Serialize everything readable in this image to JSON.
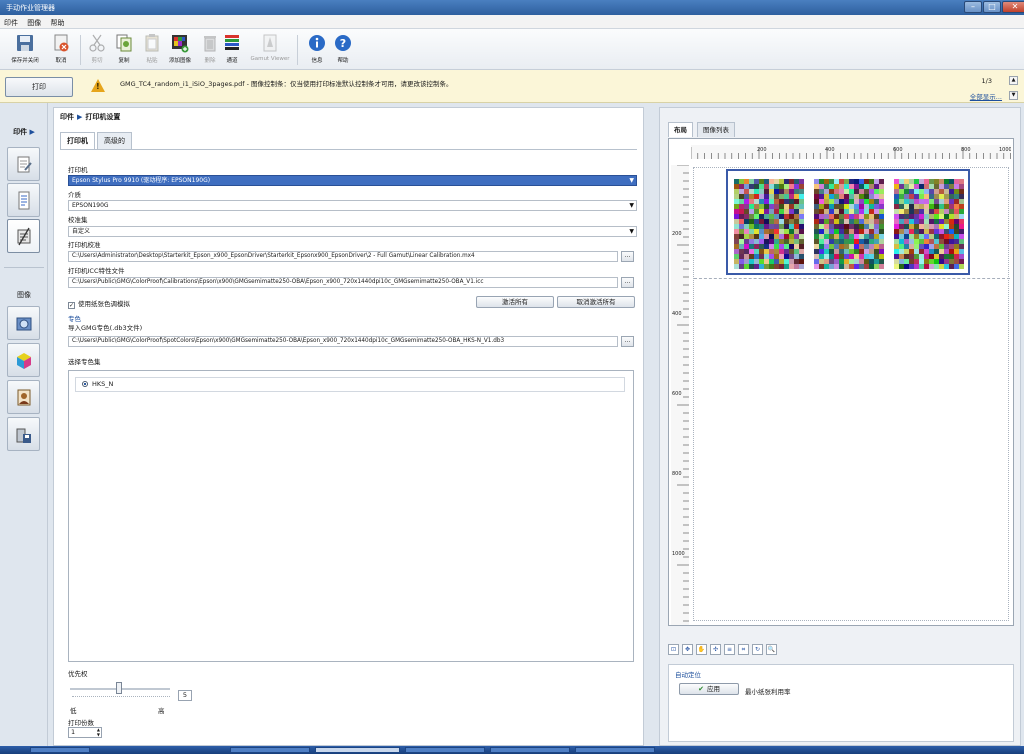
{
  "window": {
    "title": "手动作业管理器"
  },
  "menu": [
    "印件",
    "图像",
    "帮助"
  ],
  "toolbar": {
    "buttons": [
      {
        "label": "保存并关闭",
        "icon": "save-icon",
        "disabled": false
      },
      {
        "label": "取消",
        "icon": "cancel-icon",
        "disabled": false
      },
      {
        "label": "剪切",
        "icon": "scissors-icon",
        "disabled": true
      },
      {
        "label": "复制",
        "icon": "copy-icon",
        "disabled": false
      },
      {
        "label": "粘贴",
        "icon": "paste-icon",
        "disabled": true
      },
      {
        "label": "添加图像",
        "icon": "add-image-icon",
        "disabled": false
      },
      {
        "label": "删除",
        "icon": "trash-icon",
        "disabled": true
      },
      {
        "label": "通道",
        "icon": "channels-icon",
        "disabled": false
      },
      {
        "label": "Gamut Viewer",
        "icon": "gamut-viewer-icon",
        "disabled": true
      },
      {
        "label": "信息",
        "icon": "info-icon",
        "disabled": false
      },
      {
        "label": "帮助",
        "icon": "help-icon",
        "disabled": false
      }
    ]
  },
  "notice": {
    "print_button": "打印",
    "message": "GMG_TC4_random_i1_iSiO_3pages.pdf - 图像控制条：仅当使用打印标准默认控制条才可用，请更改该控制条。",
    "page_counter": "1/3",
    "show_all": "全部显示..."
  },
  "left_nav": {
    "section1": "印件",
    "section2": "图像"
  },
  "main": {
    "breadcrumb": {
      "root": "印件",
      "current": "打印机设置"
    },
    "tabs": [
      "打印机",
      "高级的"
    ],
    "printer_label": "打印机",
    "printer_value": "Epson Stylus Pro 9910 (驱动程序: EPSON190G)",
    "media_label": "介质",
    "media_value": "EPSON190G",
    "calibset_label": "校准集",
    "calibset_value": "自定义",
    "calib_label": "打印机校准",
    "calib_value": "C:\\Users\\Administrator\\Desktop\\Starterkit_Epson_x900_EpsonDriver\\Starterkit_Epsonx900_EpsonDriver\\2 - Full Gamut\\Linear Calibration.mx4",
    "icc_label": "打印机ICC特性文件",
    "icc_value": "C:\\Users\\Public\\GMG\\ColorProof\\Calibrations\\Epson\\x900\\GMGsemimatte250-OBA\\Epson_x900_720x1440dpi10c_GMGsemimatte250-OBA_V1.icc",
    "checkbox_label": "使用纸张色调模拟",
    "activate_all": "激活所有",
    "deactivate_all": "取消激活所有",
    "spot_header": "专色",
    "spot_import_label": "导入GMG专色(.db3文件)",
    "spot_path": "C:\\Users\\Public\\GMG\\ColorProof\\SpotColors\\Epson\\x900\\GMGsemimatte250-OBA\\Epson_x900_720x1440dpi10c_GMGsemimatte250-OBA_HKS-N_V1.db3",
    "spot_select_label": "选择专色集",
    "spot_sets": [
      "HKS_N"
    ],
    "priority_label": "优先权",
    "priority_value": "5",
    "priority_low": "低",
    "priority_high": "高",
    "copies_label": "打印份数",
    "copies_value": "1"
  },
  "right": {
    "tabs": [
      "布局",
      "图像列表"
    ],
    "ruler_h": [
      "200",
      "400",
      "600",
      "800",
      "1000"
    ],
    "ruler_v": [
      "200",
      "400",
      "600",
      "800",
      "1000"
    ],
    "auto_layout_title": "自动定位",
    "apply": "应用",
    "mode": "最小纸张利用率"
  },
  "colors": {
    "accent": "#3f6ec0",
    "notice_bg": "#fbf6d8",
    "warning": "#e6a51c"
  }
}
